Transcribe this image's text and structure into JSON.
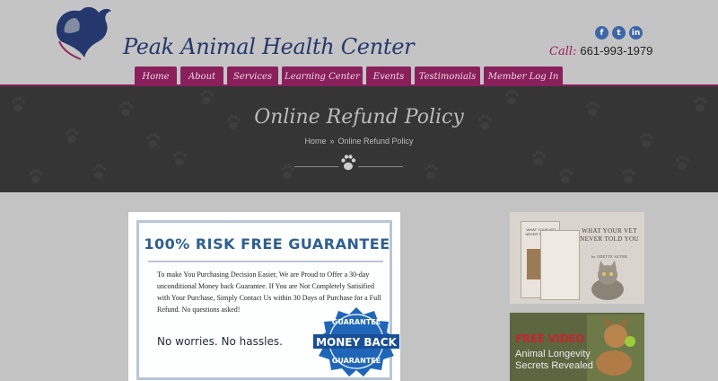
{
  "header": {
    "site_title": "Peak Animal Health Center",
    "phone_label": "Call:",
    "phone_number": "661-993-1979",
    "social": [
      {
        "name": "facebook-icon",
        "glyph": "f"
      },
      {
        "name": "twitter-icon",
        "glyph": "t"
      },
      {
        "name": "linkedin-icon",
        "glyph": "in"
      }
    ]
  },
  "nav": {
    "items": [
      "Home",
      "About",
      "Services",
      "Learning Center",
      "Events",
      "Testimonials",
      "Member Log In"
    ]
  },
  "banner": {
    "title": "Online Refund Policy",
    "breadcrumb_home": "Home",
    "breadcrumb_sep": "»",
    "breadcrumb_current": "Online Refund Policy"
  },
  "guarantee": {
    "title": "100% RISK FREE GUARANTEE",
    "body": "To make You Purchasing Decision Easier, We are Proud to Offer a 30-day unconditional Money back Guarantee. If You are Not Completely Satisified with Your Purchase, Simply Contact Us within 30 Days of Purchase for a Full Refund. No questions asked!",
    "tagline": "No worries. No hassles.",
    "seal_top": "GUARANTEE",
    "seal_mid": "MONEY BACK",
    "seal_bottom": "GUARANTEE"
  },
  "ads": {
    "book_headline": "WHAT YOUR VET NEVER TOLD YOU",
    "book_author": "by ODETTE SUTER",
    "book_cover_text": "WHAT YOUR VET NEVER TOLD YOU",
    "video_label": "FREE VIDEO",
    "video_line1": "Animal Longevity",
    "video_line2": "Secrets Revealed"
  },
  "colors": {
    "nav_bg": "#89205c",
    "title_blue": "#25386d",
    "banner_bg": "#353535",
    "page_bg": "#c3c3c3"
  }
}
